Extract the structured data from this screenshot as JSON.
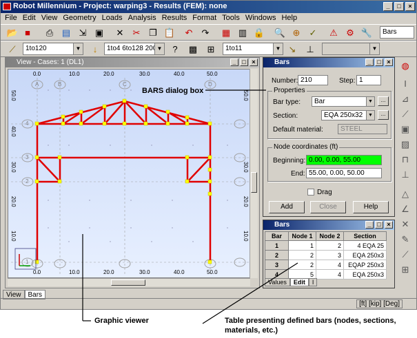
{
  "window": {
    "title": "Robot Millennium - Project: warping3 - Results (FEM): none",
    "buttons": [
      "_",
      "□",
      "×"
    ]
  },
  "menu": [
    "File",
    "Edit",
    "View",
    "Geometry",
    "Loads",
    "Analysis",
    "Results",
    "Format",
    "Tools",
    "Windows",
    "Help"
  ],
  "toolbar1": {
    "icons": [
      "open-icon",
      "save-icon",
      "print-icon",
      "book-icon",
      "export-icon",
      "screen-icon",
      "delete-icon",
      "cut-icon",
      "copy-icon",
      "paste-icon",
      "undo-icon",
      "redo-icon",
      "calculator-icon",
      "table-icon",
      "lock-icon",
      "zoom-icon",
      "target-icon",
      "pick-icon",
      "structure-icon",
      "gear-icon",
      "wrench-icon"
    ],
    "layout_selector": "Bars"
  },
  "toolbar2": {
    "bars_selection": "1to120",
    "cases_selection": "1to4 6to128 200to2",
    "nodes_selection": "1to11",
    "empty_combo": ""
  },
  "view": {
    "title": "View -  Cases: 1 (DL1)",
    "x_ticks": [
      "0.0",
      "10.0",
      "20.0",
      "30.0",
      "40.0",
      "50.0"
    ],
    "y_ticks": [
      "50.0",
      "40.0",
      "30.0",
      "20.0",
      "10.0",
      "0.0"
    ],
    "column_axes": [
      "A",
      "B",
      "C",
      "D"
    ],
    "row_axes": [
      "4",
      "3",
      "2",
      "1"
    ],
    "structure_color": "#e00000",
    "node_color": "#ffff00"
  },
  "bottom_tabs": [
    "View",
    "Bars"
  ],
  "status": {
    "units": "[ft] [kip] [Deg]"
  },
  "bars_dialog": {
    "title": "Bars",
    "number_label": "Number:",
    "number_value": "210",
    "step_label": "Step:",
    "step_value": "1",
    "properties_legend": "Properties",
    "bar_type_label": "Bar type:",
    "bar_type_value": "Bar",
    "section_label": "Section:",
    "section_value": "EQA 250x32",
    "material_label": "Default material:",
    "material_value": "STEEL",
    "node_coords_legend": "Node coordinates (ft)",
    "beginning_label": "Beginning:",
    "beginning_value": "0.00, 0.00, 55.00",
    "end_label": "End:",
    "end_value": "55.00, 0.00, 50.00",
    "drag_label": "Drag",
    "add_button": "Add",
    "close_button": "Close",
    "help_button": "Help"
  },
  "bars_table": {
    "title": "Bars",
    "columns": [
      "Bar",
      "Node 1",
      "Node 2",
      "Section"
    ],
    "rows": [
      [
        "1",
        "1",
        "2",
        "4 EQA 25"
      ],
      [
        "2",
        "2",
        "3",
        "EQA 250x3"
      ],
      [
        "3",
        "2",
        "4",
        "EQAP 250x3"
      ],
      [
        "4",
        "5",
        "4",
        "EQA 250x3"
      ]
    ],
    "tabs": [
      "Values",
      "Edit",
      "I"
    ]
  },
  "annotations": {
    "dialog": "BARS dialog box",
    "viewer": "Graphic viewer",
    "table": "Table presenting defined bars (nodes, sections, materials, etc.)"
  }
}
